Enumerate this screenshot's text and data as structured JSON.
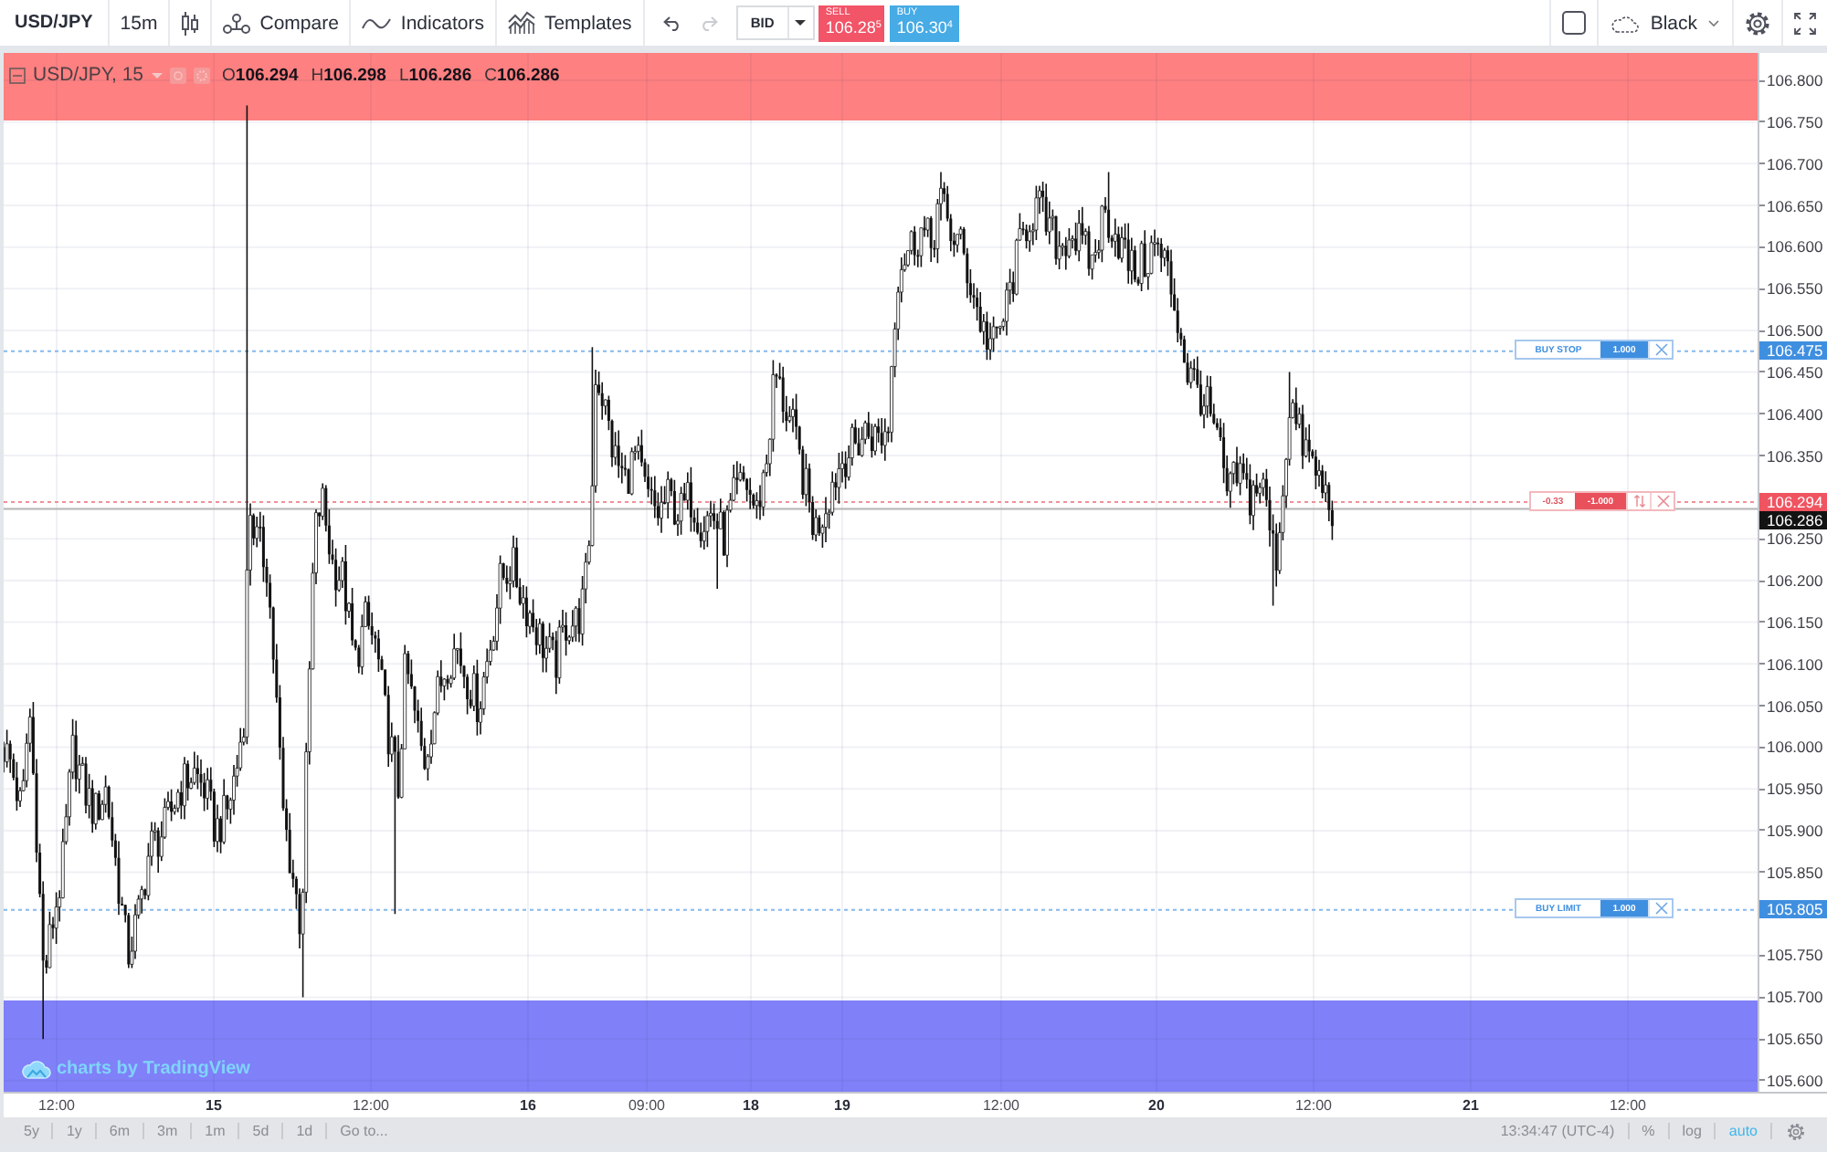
{
  "toolbar": {
    "symbol": "USD/JPY",
    "interval": "15m",
    "buttons": [
      {
        "kind": "compare",
        "label": "Compare"
      },
      {
        "kind": "indicators",
        "label": "Indicators"
      },
      {
        "kind": "templates",
        "label": "Templates"
      }
    ],
    "history": [
      {
        "kind": "undo",
        "disabled": false
      },
      {
        "kind": "redo",
        "disabled": true
      }
    ],
    "price_source": "BID",
    "trade_buttons": [
      {
        "kind": "sell",
        "label": "SELL",
        "price": "106.28$^{5}$"
      },
      {
        "kind": "buy",
        "label": "BUY",
        "price": "106.30$^{4}$"
      }
    ],
    "theme": "Black"
  },
  "legend": {
    "title": "USD/JPY, 15",
    "values": [
      {
        "label": "O",
        "value": "106.294"
      },
      {
        "label": "H",
        "value": "106.298"
      },
      {
        "label": "L",
        "value": "106.286"
      },
      {
        "label": "C",
        "value": "106.286"
      }
    ]
  },
  "price_axis": {
    "ticks": [
      "106.800",
      "106.750",
      "106.700",
      "106.650",
      "106.600",
      "106.550",
      "106.500",
      "106.450",
      "106.400",
      "106.350",
      "106.250",
      "106.200",
      "106.150",
      "106.100",
      "106.050",
      "106.000",
      "105.950",
      "105.900",
      "105.850",
      "105.750",
      "105.700",
      "105.650",
      "105.600"
    ],
    "markers": [
      {
        "kind": "order",
        "label": "106.475",
        "order": {
          "text": "BUY STOP",
          "quantity": "1.000"
        }
      },
      {
        "kind": "position",
        "label": "106.294",
        "order": {
          "text": "-0.33",
          "quantity": "-1.000"
        }
      },
      {
        "kind": "last",
        "label": "106.286"
      },
      {
        "kind": "order",
        "label": "105.805",
        "order": {
          "text": "BUY LIMIT",
          "quantity": "1.000"
        }
      }
    ]
  },
  "time_axis": [
    {
      "kind": "time",
      "label": "12:00"
    },
    {
      "kind": "day",
      "label": "15"
    },
    {
      "kind": "time",
      "label": "12:00"
    },
    {
      "kind": "day",
      "label": "16"
    },
    {
      "kind": "time",
      "label": "09:00"
    },
    {
      "kind": "day",
      "label": "18"
    },
    {
      "kind": "day",
      "label": "19"
    },
    {
      "kind": "time",
      "label": "12:00"
    },
    {
      "kind": "day",
      "label": "20"
    },
    {
      "kind": "time",
      "label": "12:00"
    },
    {
      "kind": "day",
      "label": "21"
    },
    {
      "kind": "time",
      "label": "12:00"
    }
  ],
  "branding": "charts by TradingView",
  "bottom_bar": {
    "ranges": [
      "5y",
      "1y",
      "6m",
      "3m",
      "1m",
      "5d",
      "1d"
    ],
    "goto": "Go to...",
    "clock": "13:34:47 (UTC-4)",
    "scale_options": [
      {
        "label": "%",
        "on": false
      },
      {
        "label": "log",
        "on": false
      },
      {
        "label": "auto",
        "on": true
      }
    ]
  }
}
